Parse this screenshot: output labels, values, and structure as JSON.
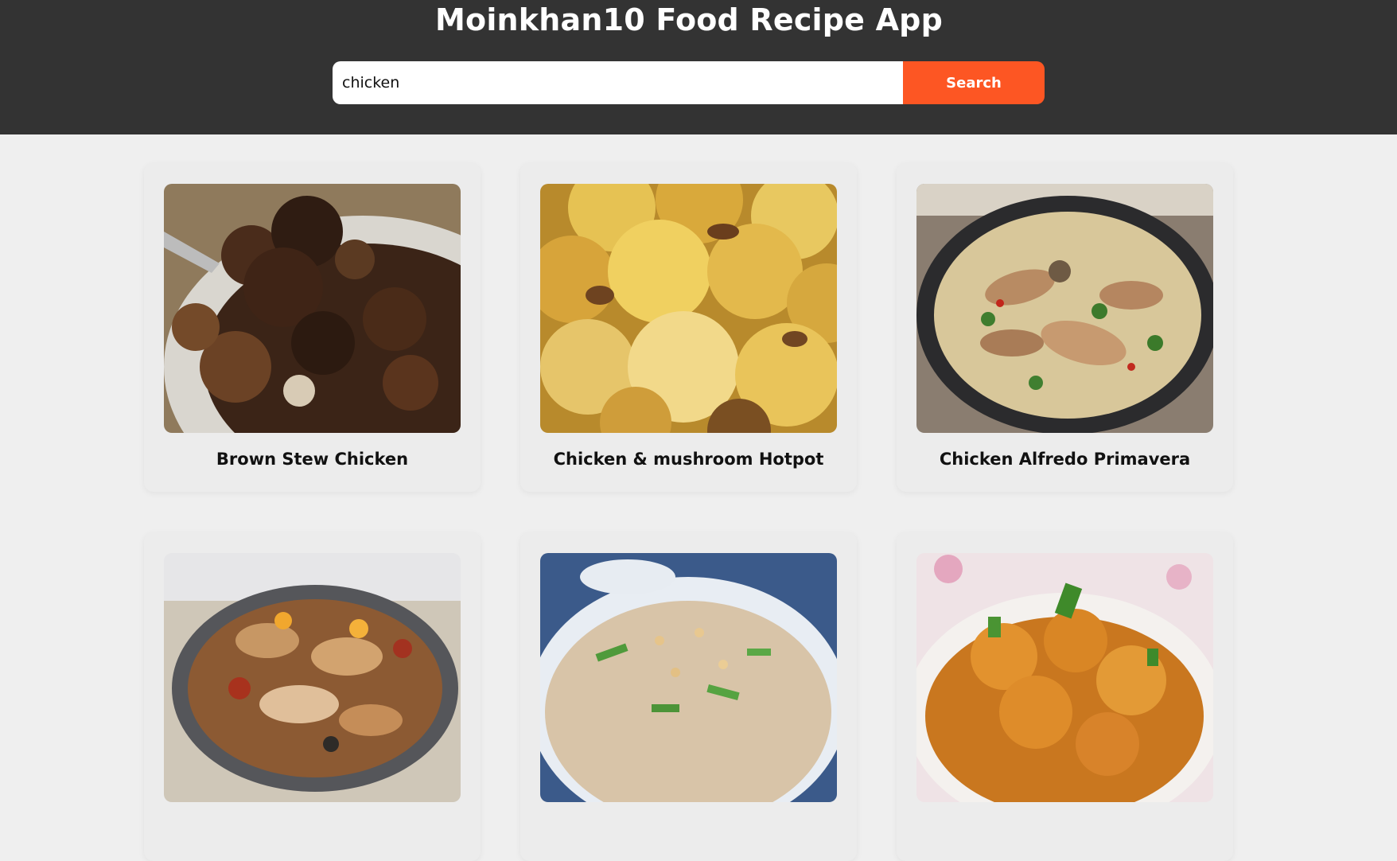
{
  "app": {
    "title": "Moinkhan10 Food Recipe App"
  },
  "search": {
    "value": "chicken",
    "button_label": "Search"
  },
  "colors": {
    "header_bg": "#333333",
    "accent": "#fd5623",
    "page_bg": "#efefef",
    "card_bg": "#ececec"
  },
  "recipes": [
    {
      "name": "Brown Stew Chicken",
      "image": "brown-stew-chicken-photo"
    },
    {
      "name": "Chicken & mushroom Hotpot",
      "image": "chicken-mushroom-hotpot-photo"
    },
    {
      "name": "Chicken Alfredo Primavera",
      "image": "chicken-alfredo-primavera-photo"
    },
    {
      "name": "",
      "image": "chicken-casserole-photo"
    },
    {
      "name": "",
      "image": "chicken-congee-photo"
    },
    {
      "name": "",
      "image": "chicken-curry-photo"
    }
  ]
}
